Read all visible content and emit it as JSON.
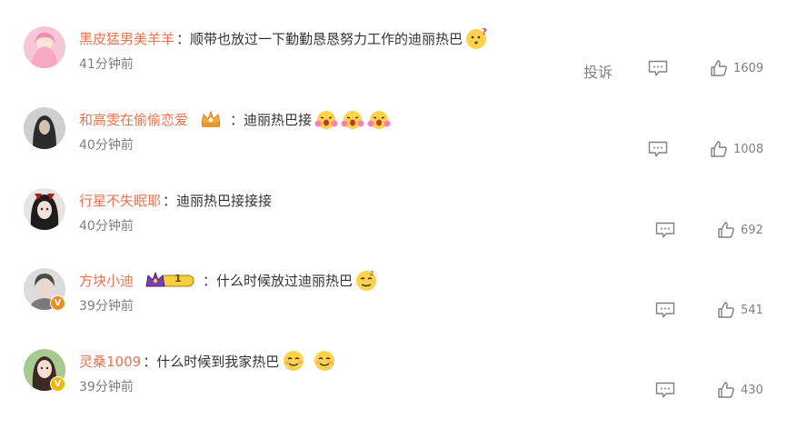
{
  "comments": [
    {
      "username": "黑皮猛男美羊羊",
      "text": "：顺带也放过一下勤勤恳恳努力工作的迪丽热巴",
      "time": "41分钟前",
      "likes": "1609",
      "report_label": "投诉"
    },
    {
      "username": "和高雯在偷偷恋爱",
      "text": "：迪丽热巴接",
      "time": "40分钟前",
      "likes": "1008"
    },
    {
      "username": "行星不失眠耶",
      "text": "：迪丽热巴接接接",
      "time": "40分钟前",
      "likes": "692"
    },
    {
      "username": "方块小迪",
      "text": "：什么时候放过迪丽热巴",
      "time": "39分钟前",
      "likes": "541",
      "level": "1"
    },
    {
      "username": "灵桑1009",
      "text": "：什么时候到我家热巴",
      "time": "39分钟前",
      "likes": "430"
    }
  ],
  "colors": {
    "username": "#eb7350",
    "verified_orange": "#f08b1e",
    "verified_gold": "#f2b400"
  }
}
